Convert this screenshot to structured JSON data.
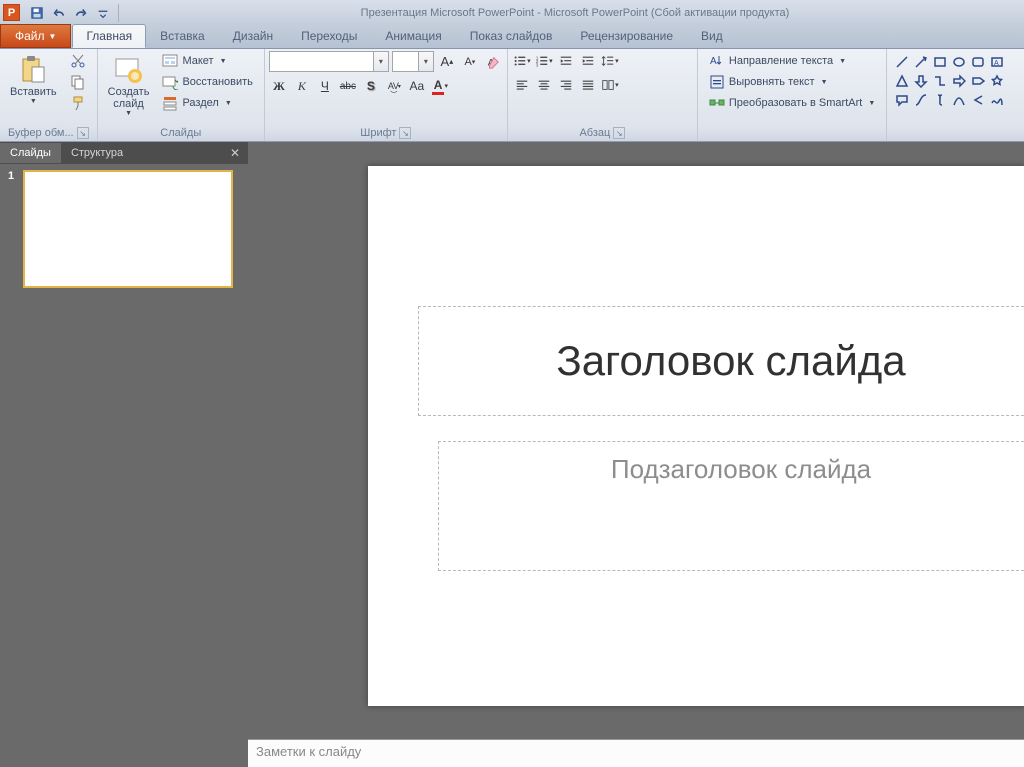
{
  "titlebar": {
    "app_logo_letter": "P",
    "title": "Презентация Microsoft PowerPoint - Microsoft PowerPoint (Сбой активации продукта)"
  },
  "tabs": {
    "file": "Файл",
    "items": [
      "Главная",
      "Вставка",
      "Дизайн",
      "Переходы",
      "Анимация",
      "Показ слайдов",
      "Рецензирование",
      "Вид"
    ],
    "active_index": 0
  },
  "ribbon": {
    "clipboard": {
      "paste": "Вставить",
      "label": "Буфер обм..."
    },
    "slides": {
      "new_slide": "Создать\nслайд",
      "layout": "Макет",
      "reset": "Восстановить",
      "section": "Раздел",
      "label": "Слайды"
    },
    "font": {
      "grow": "A",
      "shrink": "A",
      "clear": "Aₐ",
      "bold": "Ж",
      "italic": "К",
      "under": "Ч",
      "strike": "abc",
      "shadow": "S",
      "spacing": "AV",
      "case": "Aa",
      "color_a": "A",
      "label": "Шрифт"
    },
    "para": {
      "direction": "Направление текста",
      "align_text": "Выровнять текст",
      "smartart": "Преобразовать в SmartArt",
      "label": "Абзац"
    }
  },
  "sidepanel": {
    "tab_slides": "Слайды",
    "tab_outline": "Структура",
    "thumb_number": "1"
  },
  "slide": {
    "title_placeholder": "Заголовок слайда",
    "subtitle_placeholder": "Подзаголовок слайда"
  },
  "notes": {
    "placeholder": "Заметки к слайду"
  }
}
